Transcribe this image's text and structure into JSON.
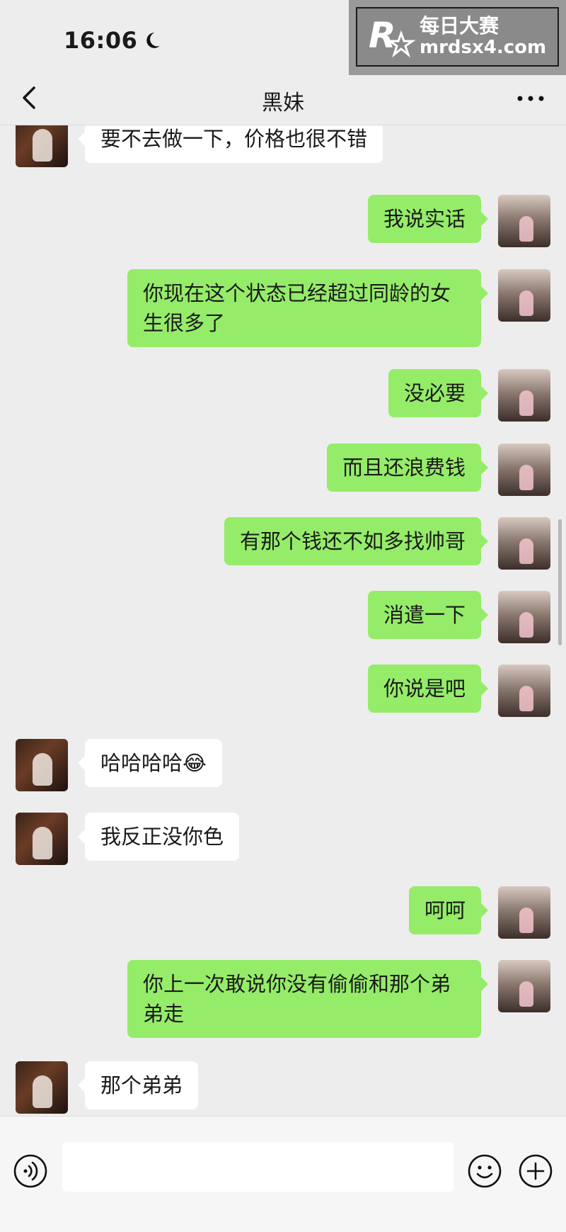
{
  "status_bar": {
    "time": "16:06",
    "icons": [
      "moon-icon"
    ]
  },
  "watermark": {
    "logo_letter": "R",
    "title": "每日大赛",
    "url": "mrdsx4.com"
  },
  "header": {
    "title": "黑妹",
    "back_icon": "chevron-left-icon",
    "more_icon": "ellipsis-icon"
  },
  "messages": [
    {
      "side": "left",
      "text": "要不去做一下，价格也很不错"
    },
    {
      "side": "right",
      "text": "我说实话"
    },
    {
      "side": "right",
      "text": "你现在这个状态已经超过同龄的女\n生很多了"
    },
    {
      "side": "right",
      "text": "没必要"
    },
    {
      "side": "right",
      "text": "而且还浪费钱"
    },
    {
      "side": "right",
      "text": "有那个钱还不如多找帅哥"
    },
    {
      "side": "right",
      "text": "消遣一下"
    },
    {
      "side": "right",
      "text": "你说是吧"
    },
    {
      "side": "left",
      "text": "哈哈哈哈😂"
    },
    {
      "side": "left",
      "text": "我反正没你色"
    },
    {
      "side": "right",
      "text": "呵呵"
    },
    {
      "side": "right",
      "text": "你上一次敢说你没有偷偷和那个弟\n弟走"
    },
    {
      "side": "left",
      "text": "那个弟弟"
    }
  ],
  "input_bar": {
    "placeholder": "",
    "voice_icon": "voice-icon",
    "emoji_icon": "emoji-icon",
    "plus_icon": "plus-icon"
  },
  "colors": {
    "background": "#ededed",
    "outgoing_bubble": "#95ec69",
    "incoming_bubble": "#ffffff"
  }
}
